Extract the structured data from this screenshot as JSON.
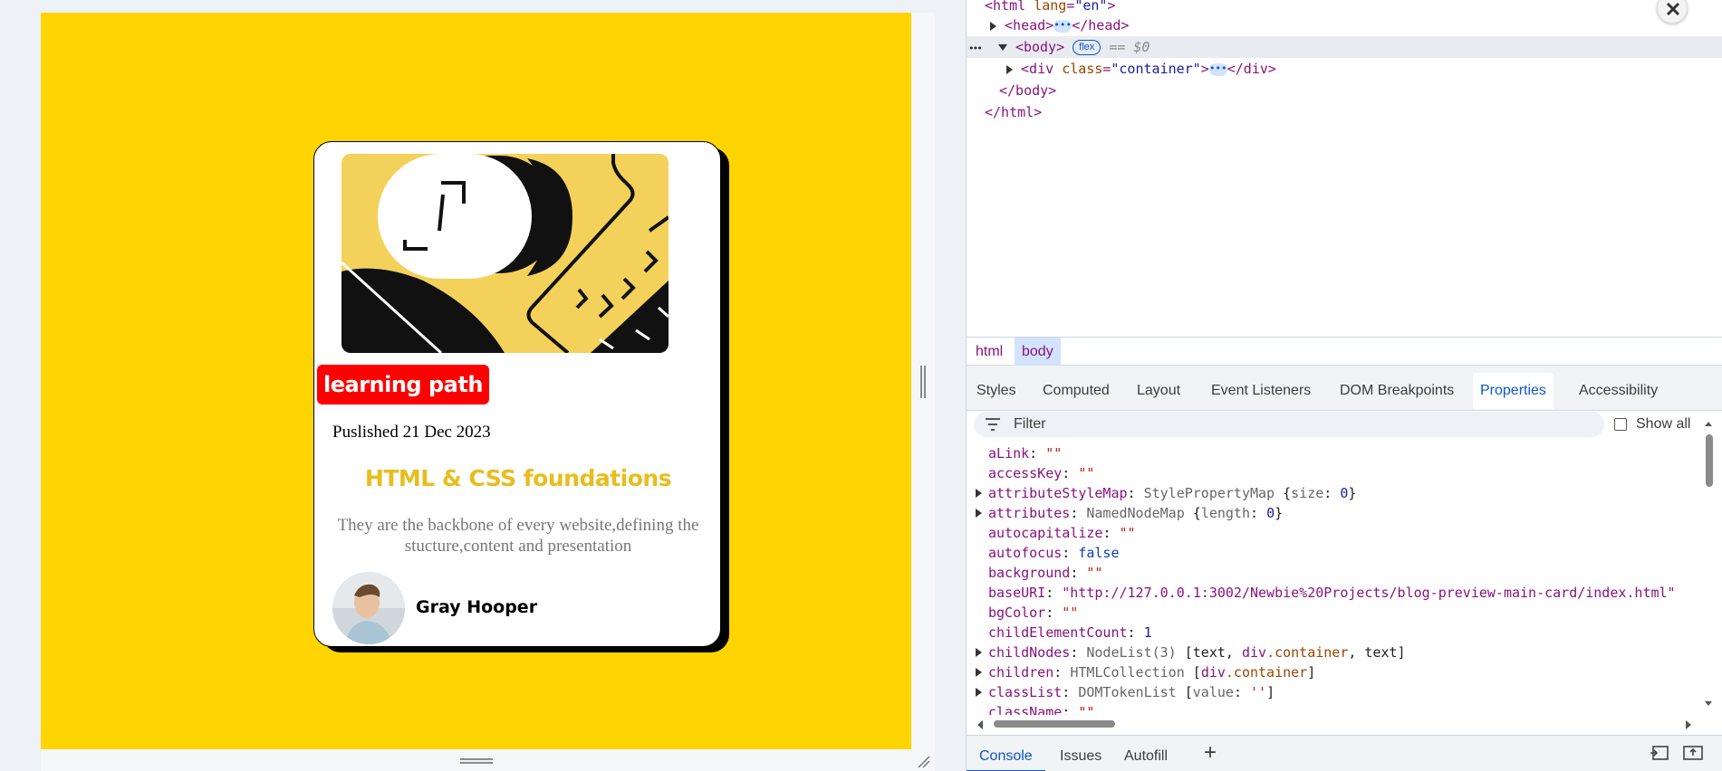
{
  "viewport": {
    "background": "#ffd400",
    "card": {
      "badge": "learning path",
      "badge_color": "#ff0000",
      "date": "Puslished 21 Dec 2023",
      "title": "HTML & CSS foundations",
      "title_color": "#e8bd1e",
      "description": "They are the backbone of every website,defining the stucture,content and presentation",
      "author": "Gray Hooper",
      "illustration_icon": "abstract-illustration",
      "avatar_icon": "avatar-photo"
    }
  },
  "devtools": {
    "dom": {
      "html_open": "<html lang=\"en\">",
      "head": {
        "open": "<head>",
        "close": "</head>"
      },
      "body": {
        "open": "<body>",
        "badge": "flex",
        "marker": "== $0",
        "close": "</body>"
      },
      "div": {
        "open_tag": "<div",
        "attr": "class",
        "value": "\"container\"",
        "open_end": ">",
        "close": "</div>"
      },
      "html_close": "</html>",
      "ellipsis": "•••",
      "row_menu": "•••"
    },
    "breadcrumbs": [
      "html",
      "body"
    ],
    "panel_tabs": [
      "Styles",
      "Computed",
      "Layout",
      "Event Listeners",
      "DOM Breakpoints",
      "Properties",
      "Accessibility"
    ],
    "active_panel_tab": "Properties",
    "filter_placeholder": "Filter",
    "show_all_label": "Show all",
    "properties": [
      {
        "key": "aLink",
        "parts": [
          {
            "t": "\"\"",
            "c": "pstr"
          }
        ]
      },
      {
        "key": "accessKey",
        "parts": [
          {
            "t": "\"\"",
            "c": "pstr"
          }
        ]
      },
      {
        "key": "attributeStyleMap",
        "expandable": true,
        "parts": [
          {
            "t": "StylePropertyMap ",
            "c": "ptype"
          },
          {
            "t": "{",
            "c": "pobj"
          },
          {
            "t": "size",
            "c": "ptype"
          },
          {
            "t": ": ",
            "c": "pobj"
          },
          {
            "t": "0",
            "c": "pnum"
          },
          {
            "t": "}",
            "c": "pobj"
          }
        ]
      },
      {
        "key": "attributes",
        "expandable": true,
        "parts": [
          {
            "t": "NamedNodeMap ",
            "c": "ptype"
          },
          {
            "t": "{",
            "c": "pobj"
          },
          {
            "t": "length",
            "c": "ptype"
          },
          {
            "t": ": ",
            "c": "pobj"
          },
          {
            "t": "0",
            "c": "pnum"
          },
          {
            "t": "}",
            "c": "pobj"
          }
        ]
      },
      {
        "key": "autocapitalize",
        "parts": [
          {
            "t": "\"\"",
            "c": "pstr"
          }
        ]
      },
      {
        "key": "autofocus",
        "parts": [
          {
            "t": "false",
            "c": "pbool"
          }
        ]
      },
      {
        "key": "background",
        "parts": [
          {
            "t": "\"\"",
            "c": "pstr"
          }
        ]
      },
      {
        "key": "baseURI",
        "parts": [
          {
            "t": "\"http://127.0.0.1:3002/Newbie%20Projects/blog-preview-main-card/index.html\"",
            "c": "purl"
          }
        ]
      },
      {
        "key": "bgColor",
        "parts": [
          {
            "t": "\"\"",
            "c": "pstr"
          }
        ]
      },
      {
        "key": "childElementCount",
        "parts": [
          {
            "t": "1",
            "c": "pnum"
          }
        ]
      },
      {
        "key": "childNodes",
        "expandable": true,
        "parts": [
          {
            "t": "NodeList(3) ",
            "c": "ptype"
          },
          {
            "t": "[text, ",
            "c": "pobj"
          },
          {
            "t": "div",
            "c": "pkey"
          },
          {
            "t": ".container",
            "c": "attr"
          },
          {
            "t": ", text]",
            "c": "pobj"
          }
        ]
      },
      {
        "key": "children",
        "expandable": true,
        "parts": [
          {
            "t": "HTMLCollection ",
            "c": "ptype"
          },
          {
            "t": "[",
            "c": "pobj"
          },
          {
            "t": "div",
            "c": "pkey"
          },
          {
            "t": ".container",
            "c": "attr"
          },
          {
            "t": "]",
            "c": "pobj"
          }
        ]
      },
      {
        "key": "classList",
        "expandable": true,
        "parts": [
          {
            "t": "DOMTokenList ",
            "c": "ptype"
          },
          {
            "t": "[",
            "c": "pobj"
          },
          {
            "t": "value",
            "c": "ptype"
          },
          {
            "t": ": ",
            "c": "pobj"
          },
          {
            "t": "''",
            "c": "pstr"
          },
          {
            "t": "]",
            "c": "pobj"
          }
        ]
      },
      {
        "key": "className",
        "parts": [
          {
            "t": "\"\"",
            "c": "pstr"
          }
        ]
      }
    ],
    "drawer_tabs": [
      "Console",
      "Issues",
      "Autofill"
    ],
    "active_drawer_tab": "Console",
    "add_tab_label": "+"
  }
}
